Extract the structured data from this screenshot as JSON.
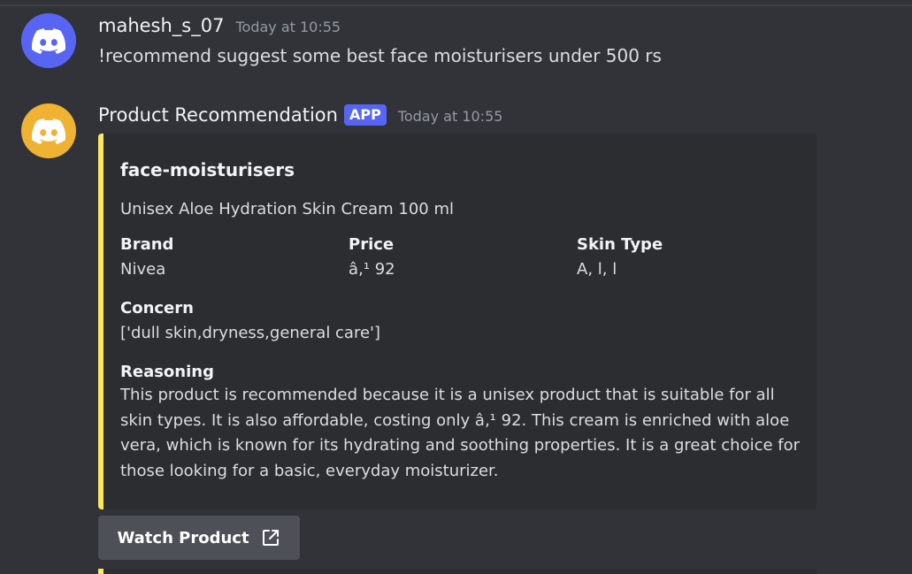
{
  "messages": [
    {
      "username": "mahesh_s_07",
      "timestamp": "Today at 10:55",
      "avatar_icon": "discord-logo-icon",
      "avatar_color": "#5865f2",
      "content": "!recommend suggest some best face moisturisers under 500 rs"
    },
    {
      "username": "Product Recommendation",
      "badge": "APP",
      "timestamp": "Today at 10:55",
      "avatar_icon": "discord-logo-icon",
      "avatar_color": "#f0b232"
    }
  ],
  "embed": {
    "accent_color": "#fee75c",
    "title": "face-moisturisers",
    "description": "Unisex Aloe Hydration Skin Cream 100 ml",
    "fields": [
      {
        "name": "Brand",
        "value": "Nivea"
      },
      {
        "name": "Price",
        "value": "â‚¹ 92"
      },
      {
        "name": "Skin Type",
        "value": "A, l, l"
      },
      {
        "name": "Concern",
        "value": "['dull skin,dryness,general care']"
      },
      {
        "name": "Reasoning",
        "value": "This product is recommended because it is a unisex product that is suitable for all skin types. It is also affordable, costing only â‚¹ 92. This cream is enriched with aloe vera, which is known for its hydrating and soothing properties. It is a great choice for those looking for a basic, everyday moisturizer."
      }
    ]
  },
  "button": {
    "label": "Watch Product",
    "icon": "external-link-icon"
  }
}
